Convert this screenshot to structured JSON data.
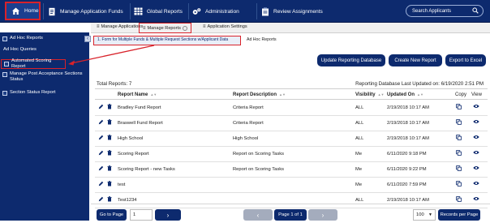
{
  "topnav": {
    "home": "Home",
    "funds": "Manage Application Funds",
    "reports": "Global Reports",
    "admin": "Administration",
    "review": "Review Assignments",
    "search_placeholder": "Search Applicants"
  },
  "subnav": {
    "manage_apps": "Manage Applications",
    "manage_reports": "Manage Reports",
    "app_settings": "Application Settings"
  },
  "sidebar": {
    "items": [
      {
        "label": "Ad Hoc Reports"
      },
      {
        "label": "Ad Hoc Queries"
      },
      {
        "label": "Automated Scoring Report"
      },
      {
        "label": "Manage Post Acceptance Sections Status"
      },
      {
        "label": "Section Status Report"
      }
    ]
  },
  "crumbs": {
    "form": "1. Form for Multiple Funds & Multiple Request Sections w/Applicant Data",
    "adhoc": "Ad Hoc Reports"
  },
  "actions": {
    "update": "Update Reporting Database",
    "create": "Create New Report",
    "export": "Export to Excel"
  },
  "summary": {
    "total": "Total Reports: 7",
    "last_updated": "Reporting Database Last Updated on: 6/19/2020 2:51 PM"
  },
  "table": {
    "headers": {
      "name": "Report Name",
      "desc": "Report Description",
      "vis": "Visibility",
      "upd": "Updated On",
      "copy": "Copy",
      "view": "View"
    },
    "rows": [
      {
        "name": "Bradley Fund Report",
        "desc": "Criteria Report",
        "vis": "ALL",
        "upd": "2/19/2018 10:17 AM"
      },
      {
        "name": "Braswell Fund Report",
        "desc": "Criteria Report",
        "vis": "ALL",
        "upd": "2/19/2018 10:17 AM"
      },
      {
        "name": "High School",
        "desc": "High School",
        "vis": "ALL",
        "upd": "2/19/2018 10:17 AM"
      },
      {
        "name": "Scoring Report",
        "desc": "Report on Scoring Tasks",
        "vis": "Me",
        "upd": "6/11/2020 9:18 PM"
      },
      {
        "name": "Scoring Report - new Tasks",
        "desc": "Report on Scoring Tasks",
        "vis": "Me",
        "upd": "6/11/2020 9:22 PM"
      },
      {
        "name": "test",
        "desc": "",
        "vis": "Me",
        "upd": "6/11/2020 7:59 PM"
      },
      {
        "name": "Test1234",
        "desc": "",
        "vis": "ALL",
        "upd": "2/19/2018 10:17 AM"
      }
    ]
  },
  "pager": {
    "goto": "Go to Page",
    "page_value": "1",
    "page_of": "Page 1 of 1",
    "per_page_value": "100",
    "records_per_page": "Records per Page"
  },
  "colors": {
    "nav": "#0d2a6e",
    "highlight": "#d8222a",
    "disabled": "#a4acbd"
  }
}
